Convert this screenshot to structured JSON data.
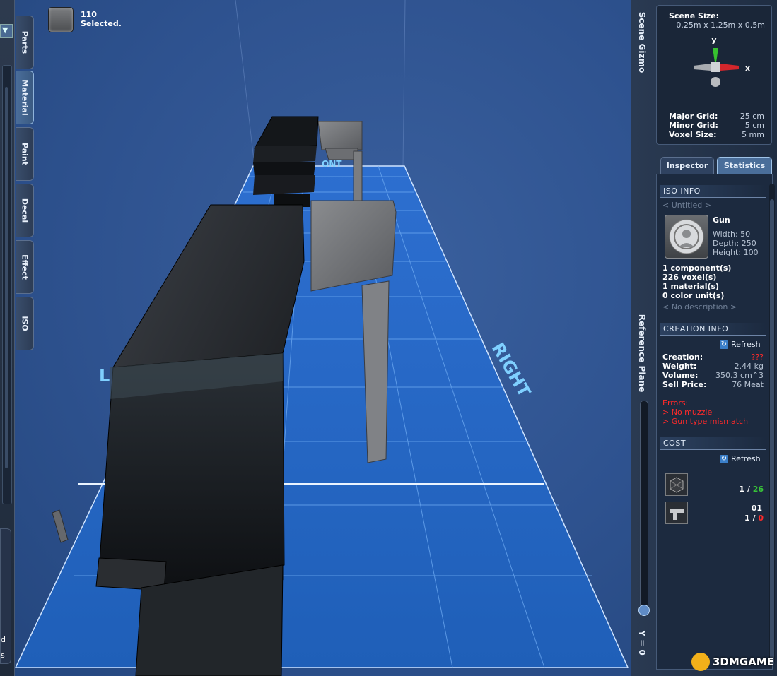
{
  "selection": {
    "count": "110",
    "label": "Selected."
  },
  "left_tabs": [
    "Parts",
    "Material",
    "Paint",
    "Decal",
    "Effect",
    "ISO"
  ],
  "left_bottom_fragments": [
    "d",
    "s"
  ],
  "viewport": {
    "label_right": "RIGHT",
    "label_front_partial": "ONT",
    "label_left_partial": "L"
  },
  "right_panel": {
    "scene_gizmo_tab": "Scene Gizmo",
    "reference_plane_tab": "Reference Plane",
    "reference_plane_value": "Y = 0",
    "scene_size_label": "Scene Size:",
    "scene_size_value": "0.25m x 1.25m x 0.5m",
    "axis_y": "y",
    "axis_x": "x",
    "major_grid_label": "Major Grid:",
    "major_grid_value": "25 cm",
    "minor_grid_label": "Minor Grid:",
    "minor_grid_value": "5 cm",
    "voxel_size_label": "Voxel Size:",
    "voxel_size_value": "5 mm",
    "tabs": [
      "Inspector",
      "Statistics"
    ],
    "active_tab": "Statistics"
  },
  "iso_info": {
    "header": "ISO INFO",
    "name": "< Untitled >",
    "type": "Gun",
    "width": "Width: 50",
    "depth": "Depth: 250",
    "height": "Height: 100",
    "components": "1 component(s)",
    "voxels": "226 voxel(s)",
    "materials": "1 material(s)",
    "color_units": "0 color unit(s)",
    "description": "< No description >"
  },
  "creation_info": {
    "header": "CREATION INFO",
    "refresh": "Refresh",
    "creation_label": "Creation:",
    "creation_value": "???",
    "weight_label": "Weight:",
    "weight_value": "2.44 kg",
    "volume_label": "Volume:",
    "volume_value": "350.3 cm^3",
    "price_label": "Sell Price:",
    "price_value": "76 Meat",
    "errors_label": "Errors:",
    "errors": [
      "> No muzzle",
      "> Gun type mismatch"
    ]
  },
  "cost": {
    "header": "COST",
    "refresh": "Refresh",
    "items": [
      {
        "label": "",
        "have": "1",
        "sep": " / ",
        "need": "26",
        "need_color": "#38c438",
        "icon": "voxel-block-icon"
      },
      {
        "label": "01",
        "have": "1",
        "sep": " / ",
        "need": "0",
        "need_color": "#ff2a2a",
        "icon": "gun-part-icon"
      }
    ]
  },
  "watermark": "3DMGAME"
}
